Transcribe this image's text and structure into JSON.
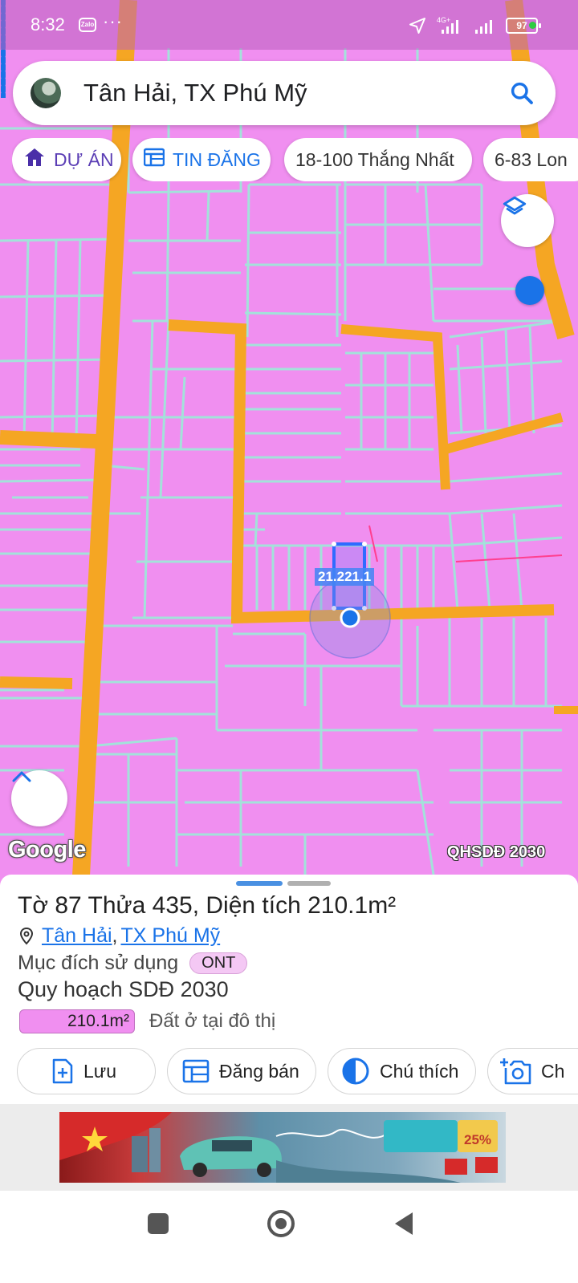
{
  "status_bar": {
    "time": "8:32",
    "zalo": "Zalo",
    "network": "4G+",
    "battery": "97"
  },
  "search": {
    "query": "Tân Hải, TX Phú Mỹ"
  },
  "chips": [
    {
      "label": "DỰ ÁN",
      "icon": "home-icon"
    },
    {
      "label": "TIN ĐĂNG",
      "icon": "listing-icon"
    },
    {
      "label": "18-100 Thắng Nhất"
    },
    {
      "label": "6-83 Lon"
    }
  ],
  "map": {
    "parcel_label": "21.221.1",
    "attribution": "Google",
    "layer_label": "QHSDĐ 2030",
    "colors": {
      "land": "#f08ff0",
      "road": "#f5a623",
      "boundary": "#9fe7d9",
      "accent": "#1a73e8"
    }
  },
  "parcel": {
    "to_prefix": "Tờ",
    "to_value": "87",
    "thua_prefix": "Thửa",
    "thua_value": "435",
    "area_prefix": ", Diện tích",
    "area_value": "210.1",
    "area_unit": "m²",
    "ward": "Tân Hải",
    "town": "TX Phú Mỹ",
    "purpose_label": "Mục đích sử dụng",
    "purpose_code": "ONT",
    "plan_label": "Quy hoạch SDĐ 2030",
    "plan_area": "210.1m²",
    "plan_desc": "Đất ở tại đô thị"
  },
  "actions": [
    {
      "label": "Lưu",
      "icon": "add-file-icon"
    },
    {
      "label": "Đăng bán",
      "icon": "table-icon"
    },
    {
      "label": "Chú thích",
      "icon": "contrast-icon"
    },
    {
      "label": "Ch",
      "icon": "add-photo-icon"
    }
  ],
  "ad": {
    "discount": "25%"
  }
}
